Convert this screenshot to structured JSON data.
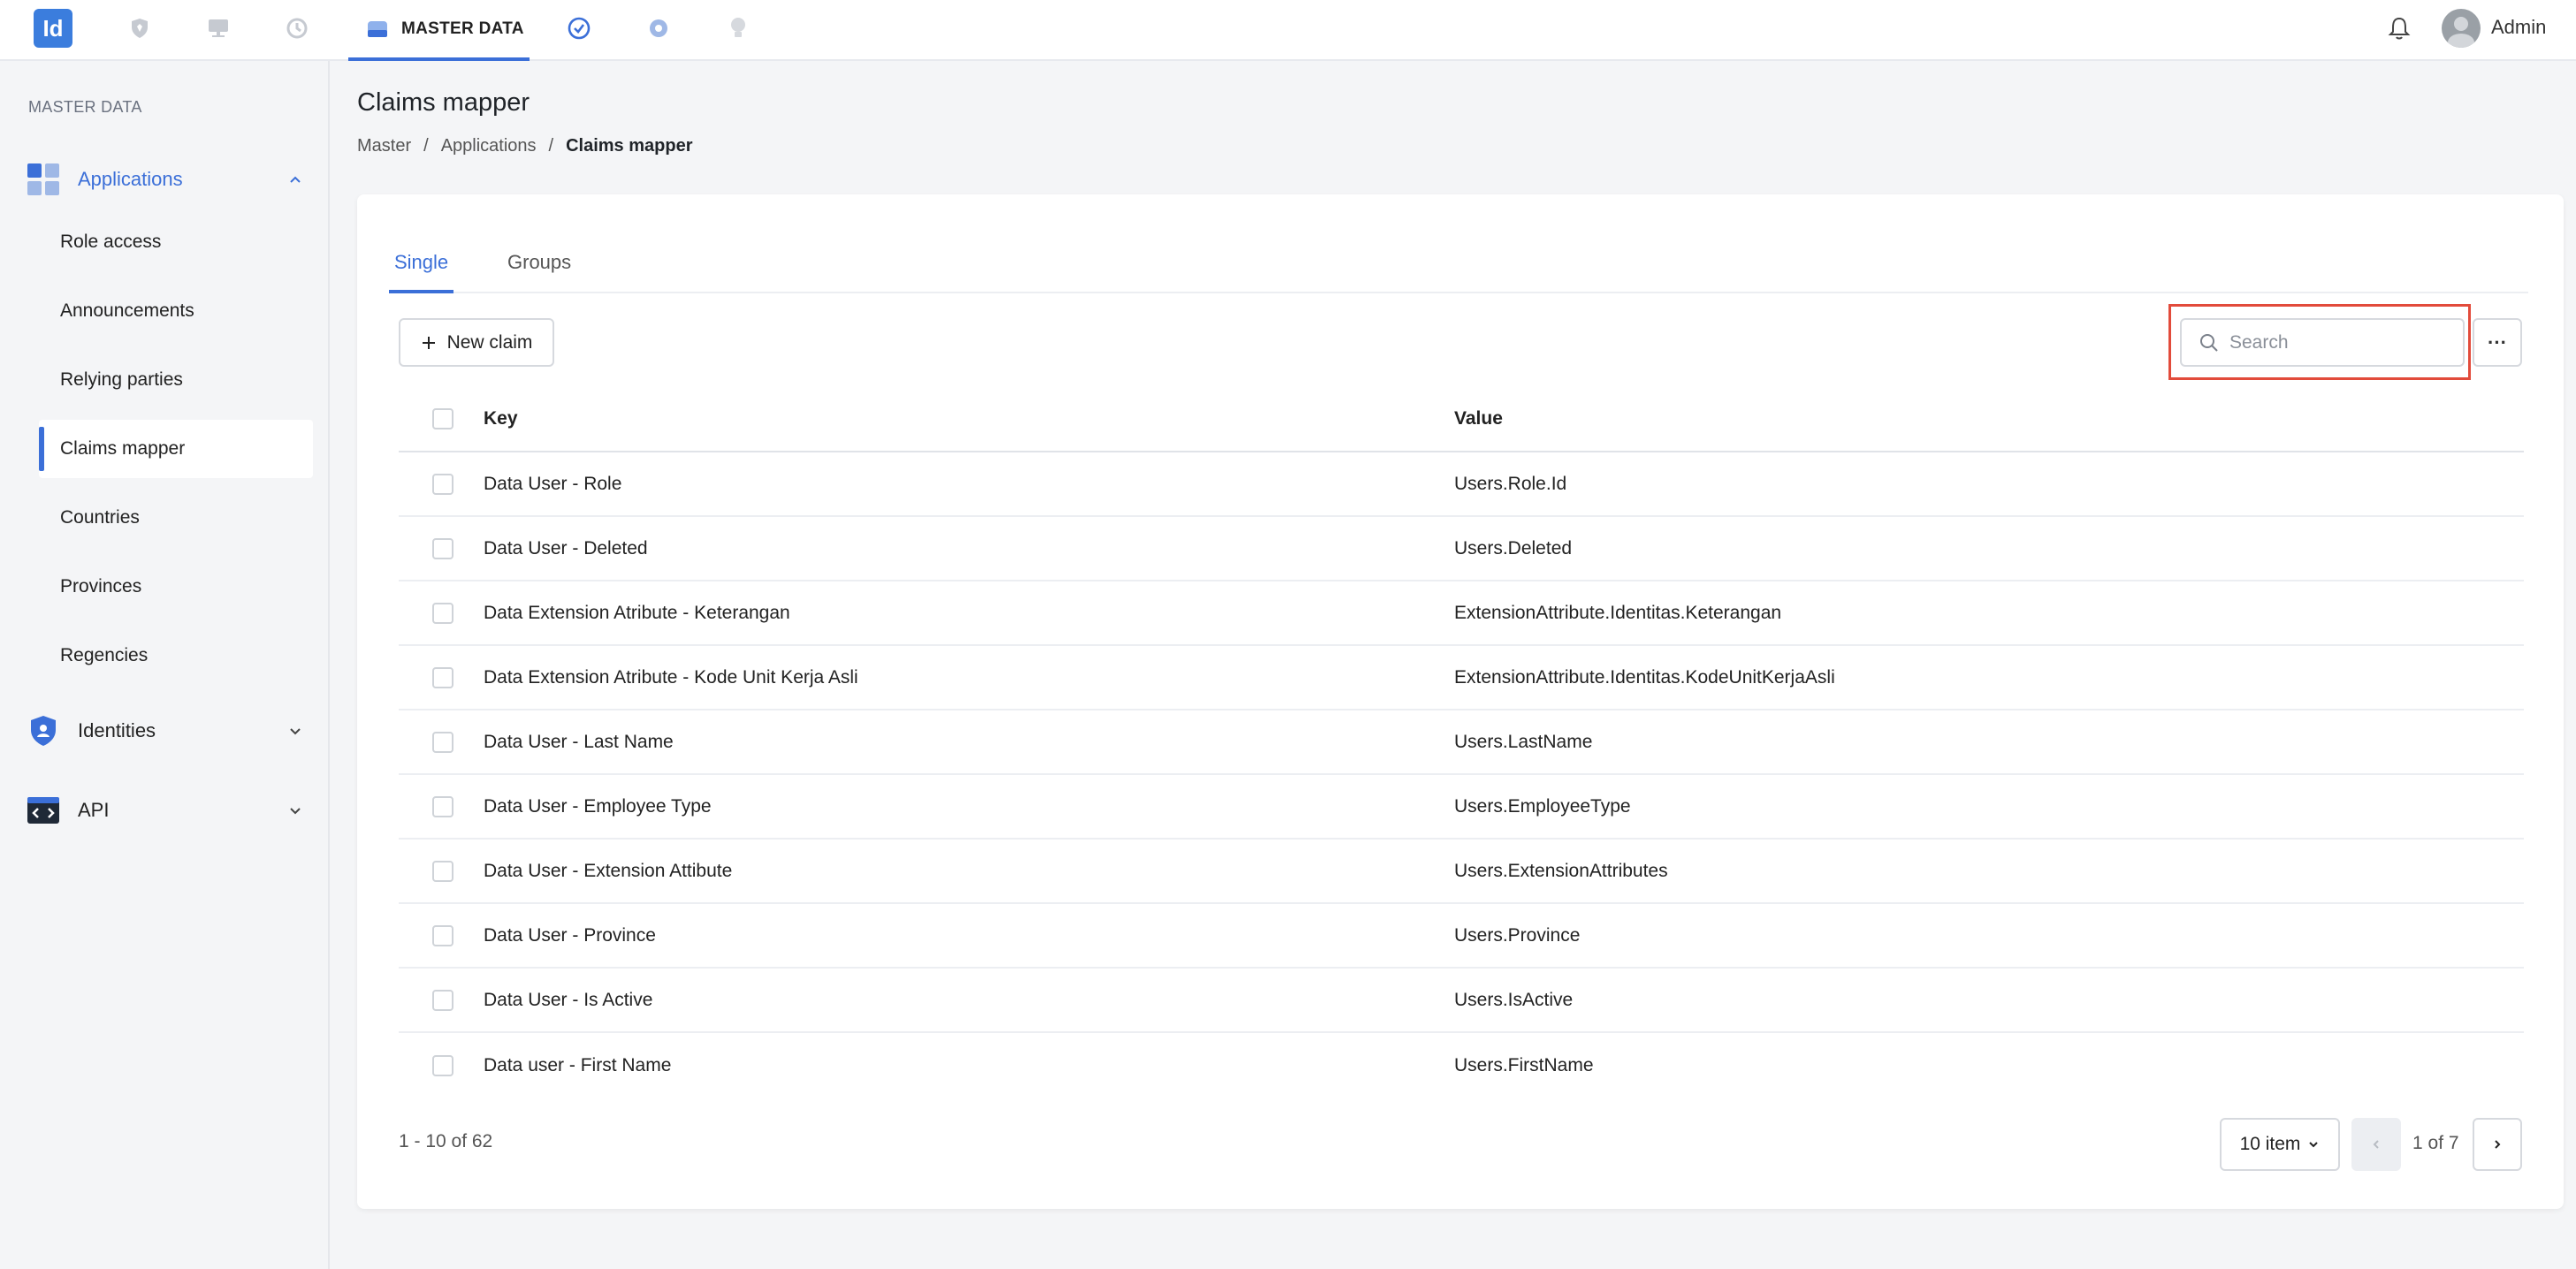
{
  "app": {
    "logo_text": "Id",
    "active_top_tab": "MASTER DATA",
    "user_name": "Admin"
  },
  "top_icons": [
    "shield-icon",
    "dashboard-icon",
    "history-icon",
    "database-icon",
    "check-circle-icon",
    "gear-icon",
    "lightbulb-icon"
  ],
  "sidebar": {
    "section_title": "MASTER DATA",
    "groups": [
      {
        "label": "Applications",
        "expanded": true,
        "items": [
          {
            "label": "Role access"
          },
          {
            "label": "Announcements"
          },
          {
            "label": "Relying parties"
          },
          {
            "label": "Claims mapper",
            "active": true
          },
          {
            "label": "Countries"
          },
          {
            "label": "Provinces"
          },
          {
            "label": "Regencies"
          }
        ]
      },
      {
        "label": "Identities",
        "expanded": false
      },
      {
        "label": "API",
        "expanded": false
      }
    ]
  },
  "page": {
    "title": "Claims mapper",
    "breadcrumb": [
      "Master",
      "Applications",
      "Claims mapper"
    ],
    "tabs": [
      {
        "label": "Single",
        "active": true
      },
      {
        "label": "Groups"
      }
    ],
    "new_button": "New claim",
    "search_placeholder": "Search",
    "more_label": "···",
    "table": {
      "columns": [
        "Key",
        "Value"
      ],
      "rows": [
        {
          "key": "Data User - Role",
          "value": "Users.Role.Id"
        },
        {
          "key": "Data User - Deleted",
          "value": "Users.Deleted"
        },
        {
          "key": "Data Extension Atribute - Keterangan",
          "value": "ExtensionAttribute.Identitas.Keterangan"
        },
        {
          "key": "Data Extension Atribute - Kode Unit Kerja Asli",
          "value": "ExtensionAttribute.Identitas.KodeUnitKerjaAsli"
        },
        {
          "key": "Data User - Last Name",
          "value": "Users.LastName"
        },
        {
          "key": "Data User - Employee Type",
          "value": "Users.EmployeeType"
        },
        {
          "key": "Data User - Extension Attibute",
          "value": "Users.ExtensionAttributes"
        },
        {
          "key": "Data User - Province",
          "value": "Users.Province"
        },
        {
          "key": "Data User - Is Active",
          "value": "Users.IsActive"
        },
        {
          "key": "Data user - First Name",
          "value": "Users.FirstName"
        }
      ]
    },
    "pagination": {
      "range": "1 - 10 of 62",
      "page_size": "10 item",
      "page_text": "1 of 7"
    }
  },
  "colors": {
    "accent": "#3b6fd8",
    "highlight": "#e24b3b"
  }
}
